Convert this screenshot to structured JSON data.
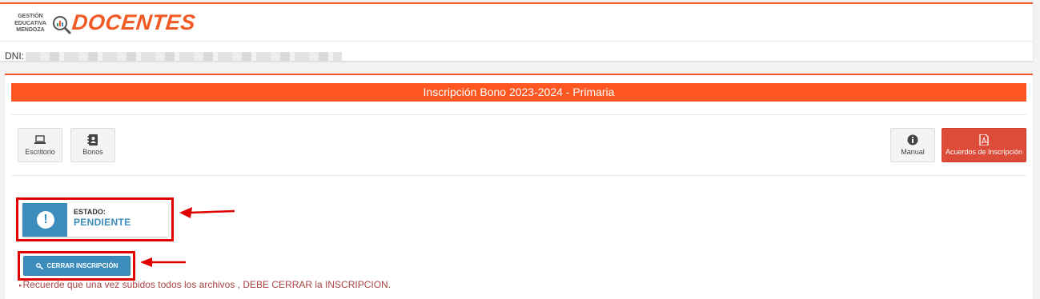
{
  "header": {
    "logo_small_text": "GESTIÓN\nEDUCATIVA\nMENDOZA",
    "logo_word": "DOCENTES",
    "dni_label": "DNI:"
  },
  "main": {
    "title": "Inscripción Bono 2023-2024 - Primaria",
    "toolbar": {
      "escritorio_label": "Escritorio",
      "bonos_label": "Bonos",
      "manual_label": "Manual",
      "acuerdos_label": "Acuerdos de Inscripción"
    },
    "estado": {
      "label": "ESTADO:",
      "value": "PENDIENTE",
      "icon": "exclamation-circle-icon"
    },
    "cerrar_button_label": "CERRAR INSCRIPCIÓN",
    "note": "Recuerde que una vez subidos todos los archivos , DEBE CERRAR la INSCRIPCION."
  },
  "colors": {
    "brand_orange": "#f15a24",
    "title_bar": "#ff5722",
    "primary_blue": "#3c8dbc",
    "danger_red": "#dd4b39",
    "annotation_red": "#e00000",
    "note_text": "#a94442"
  }
}
